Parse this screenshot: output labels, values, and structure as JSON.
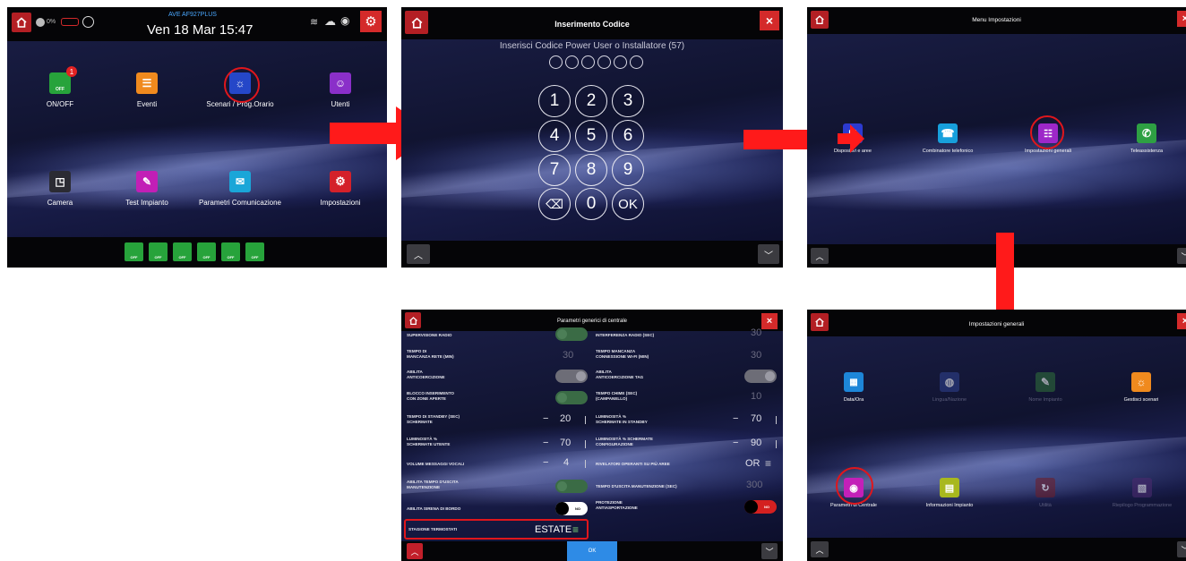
{
  "colors": {
    "accent": "#b31f24",
    "close": "#d42a2a",
    "highlight": "#e0161c",
    "arrow": "#ff1a1a",
    "ok_button": "#2e8be6",
    "toggle_on": "#3a6b45",
    "toggle_red": "#d42020"
  },
  "screen1": {
    "status": {
      "user_percent": "0%",
      "device_name": "AVE AF927PLUS",
      "datetime": "Ven 18 Mar 15:47"
    },
    "tiles": [
      {
        "label": "ON/OFF",
        "icon": "lock-open-icon",
        "color": "#27a33b",
        "badge": "1",
        "badge_icon_text": "OFF"
      },
      {
        "label": "Eventi",
        "icon": "events-icon",
        "color": "#f08a1e"
      },
      {
        "label": "Scenari / Prog.Orario",
        "icon": "scenarios-icon",
        "color": "#2547c8"
      },
      {
        "label": "Utenti",
        "icon": "users-icon",
        "color": "#8a2fc9"
      },
      {
        "label": "Camera",
        "icon": "camera-icon",
        "color": "#2b2b33"
      },
      {
        "label": "Test Impianto",
        "icon": "test-icon",
        "color": "#c21fb6"
      },
      {
        "label": "Parametri Comunicazione",
        "icon": "communication-icon",
        "color": "#1aa6d8"
      },
      {
        "label": "Impostazioni",
        "icon": "settings-icon",
        "color": "#d4212a"
      }
    ],
    "area_badges": [
      "OFF",
      "OFF",
      "OFF",
      "OFF",
      "OFF",
      "OFF"
    ]
  },
  "screen2": {
    "title": "Inserimento Codice",
    "prompt": "Inserisci Codice Power User o Installatore (57)",
    "keys": [
      "1",
      "2",
      "3",
      "4",
      "5",
      "6",
      "7",
      "8",
      "9",
      "0",
      "OK"
    ]
  },
  "screen3": {
    "title": "Menu Impostazioni",
    "tiles": [
      {
        "label": "Dispositivi e aree",
        "icon": "devices-icon",
        "color": "#2c3ad0"
      },
      {
        "label": "Combinatore telefonico",
        "icon": "phone-icon",
        "color": "#17a0dc"
      },
      {
        "label": "Impostazioni generali",
        "icon": "general-settings-icon",
        "color": "#9d27c9"
      },
      {
        "label": "Teleassistenza",
        "icon": "teleassist-icon",
        "color": "#2ea043"
      }
    ]
  },
  "screen4": {
    "title": "Impostazioni generali",
    "tiles": [
      {
        "label": "Data/Ora",
        "icon": "calendar-icon",
        "color": "#1d86d8",
        "dim": false
      },
      {
        "label": "Lingua/Nazione",
        "icon": "globe-icon",
        "color": "#2d3f8a",
        "dim": true
      },
      {
        "label": "Nome Impianto",
        "icon": "pencil-icon",
        "color": "#2e6b3a",
        "dim": true
      },
      {
        "label": "Gestisci scenari",
        "icon": "scenarios-icon",
        "color": "#f08a1e",
        "dim": false
      },
      {
        "label": "Parametri di Centrale",
        "icon": "control-panel-icon",
        "color": "#c320b8",
        "dim": false
      },
      {
        "label": "Informazioni Impianto",
        "icon": "info-icon",
        "color": "#a8b81e",
        "dim": false
      },
      {
        "label": "Utilità",
        "icon": "utility-icon",
        "color": "#6b1f2c",
        "dim": true
      },
      {
        "label": "Riepilogo Programmazione",
        "icon": "summary-icon",
        "color": "#4a2a6e",
        "dim": true
      }
    ]
  },
  "screen5": {
    "title": "Parametri generici di centrale",
    "left": [
      {
        "label": "SUPERVISIONE RADIO",
        "kind": "toggle-green",
        "value": ""
      },
      {
        "label": "TEMPO DI\nMANCANZA RETE (MIN)",
        "kind": "dim",
        "value": "30"
      },
      {
        "label": "ABILITA\nANTICOERCIZIONE",
        "kind": "toggle-grey",
        "value": ""
      },
      {
        "label": "BLOCCO INSERIMENTO\nCON ZONE APERTE",
        "kind": "toggle-green",
        "value": ""
      },
      {
        "label": "TEMPO DI STANDBY (SEC)\nSCHERMATE",
        "kind": "stepper",
        "value": "20"
      },
      {
        "label": "LUMINOSITÀ %\nSCHERMATE UTENTE",
        "kind": "stepper",
        "value": "70"
      },
      {
        "label": "VOLUME MESSAGGI VOCALI",
        "kind": "stepper",
        "value": "4"
      },
      {
        "label": "ABILITA TEMPO D'USCITA\nMANUTENZIONE",
        "kind": "toggle-green",
        "value": ""
      },
      {
        "label": "ABILITA SIRENA DI BORDO",
        "kind": "toggle-white",
        "value": "NO"
      },
      {
        "label": "STAGIONE TERMOSTATI",
        "kind": "menu",
        "value": "ESTATE"
      }
    ],
    "right": [
      {
        "label": "INTERFERENZA RADIO (SEC)",
        "kind": "dim",
        "value": "30"
      },
      {
        "label": "TEMPO MANCANZA\nCONNESSIONE WI-FI (MIN)",
        "kind": "dim",
        "value": "30"
      },
      {
        "label": "ABILITA\nANTICOERCIZIONE TAG",
        "kind": "toggle-grey",
        "value": ""
      },
      {
        "label": "TEMPO CHIME (SEC)\n(CAMPANELLO)",
        "kind": "dim",
        "value": "10"
      },
      {
        "label": "LUMINOSITÀ %\nSCHERMATE IN STANDBY",
        "kind": "stepper",
        "value": "70"
      },
      {
        "label": "LUMINOSITÀ % SCHERMATE\nCONFIGURAZIONE",
        "kind": "stepper",
        "value": "90"
      },
      {
        "label": "RIVELATORI OPERANTI SU PIÙ AREE",
        "kind": "menu",
        "value": "OR"
      },
      {
        "label": "TEMPO D'USCITA MANUTENZIONE (SEC)",
        "kind": "dim",
        "value": "300"
      },
      {
        "label": "PROTEZIONE\nANTIASPORTAZIONE",
        "kind": "toggle-red",
        "value": "NO"
      }
    ],
    "ok_label": "OK"
  }
}
